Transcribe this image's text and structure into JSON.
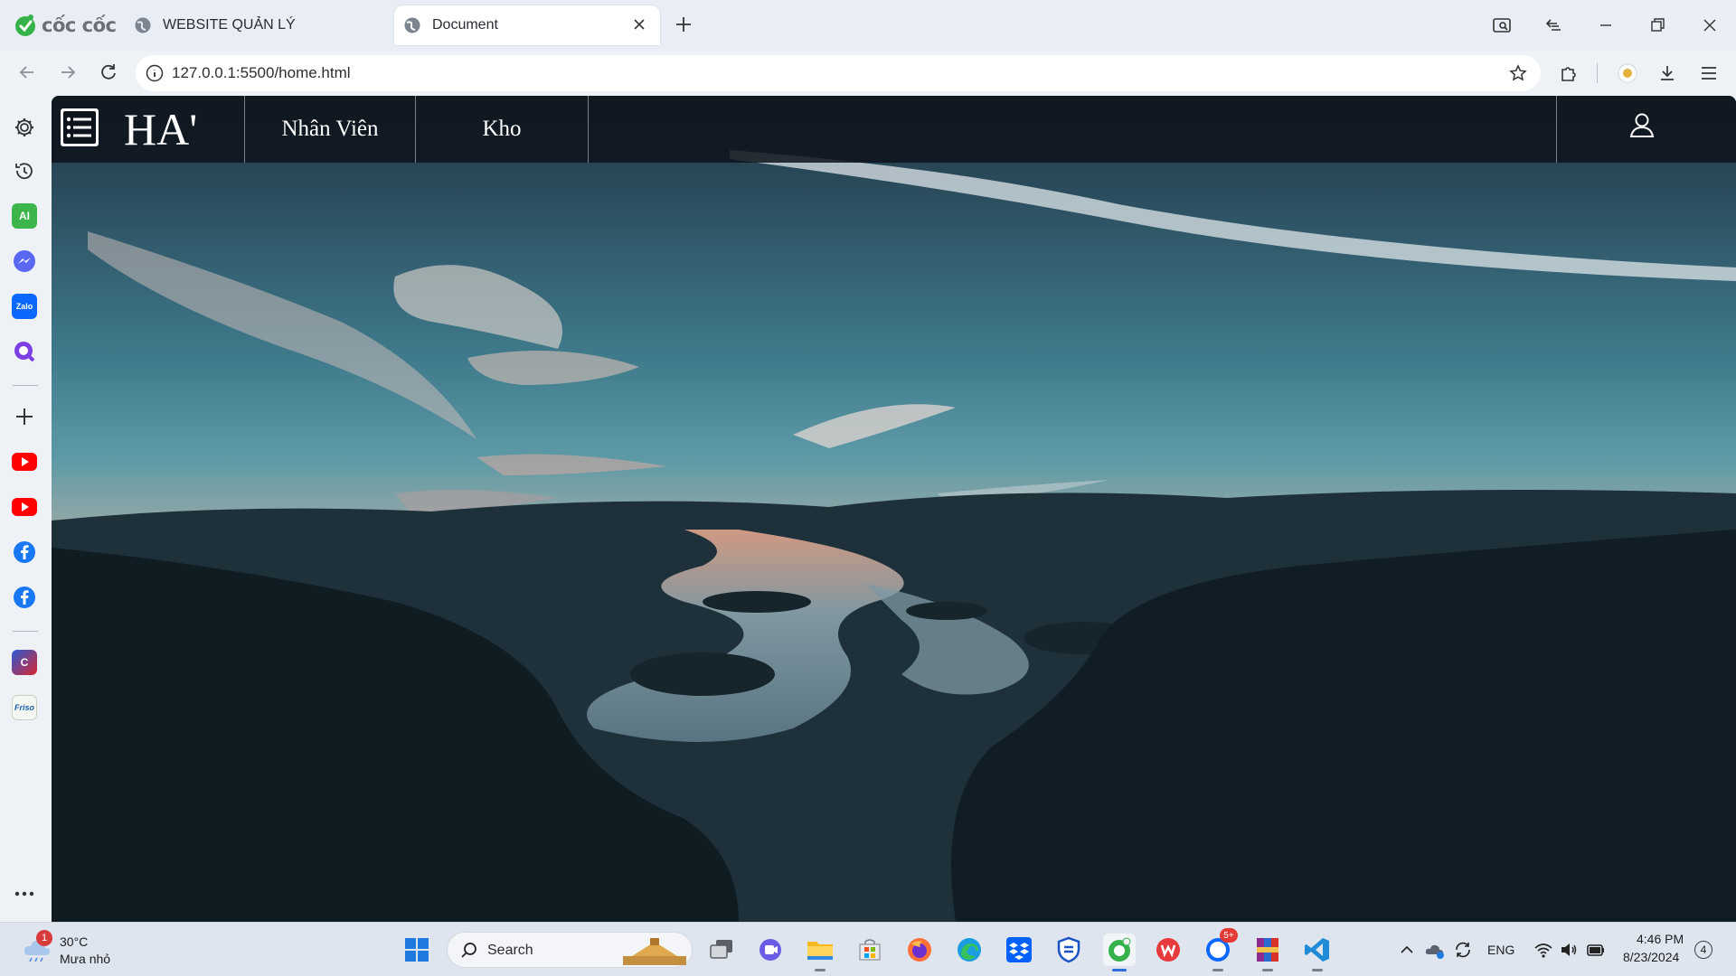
{
  "browser": {
    "brand": "cốc cốc",
    "tabs": [
      {
        "title": "WEBSITE QUẢN LÝ",
        "active": false
      },
      {
        "title": "Document",
        "active": true
      }
    ],
    "url": "127.0.0.1:5500/home.html"
  },
  "page": {
    "logo": "HA'",
    "nav": [
      "Nhân Viên",
      "Kho"
    ]
  },
  "taskbar": {
    "weather_temp": "30°C",
    "weather_desc": "Mưa nhỏ",
    "weather_badge": "1",
    "search_label": "Search",
    "zalo_badge": "5+",
    "language": "ENG",
    "time": "4:46 PM",
    "date": "8/23/2024",
    "notification_count": "4"
  },
  "colors": {
    "header_bg": "#0e141c",
    "taskbar_bg": "#dfe5ee",
    "accent": "#2d6fd8"
  }
}
